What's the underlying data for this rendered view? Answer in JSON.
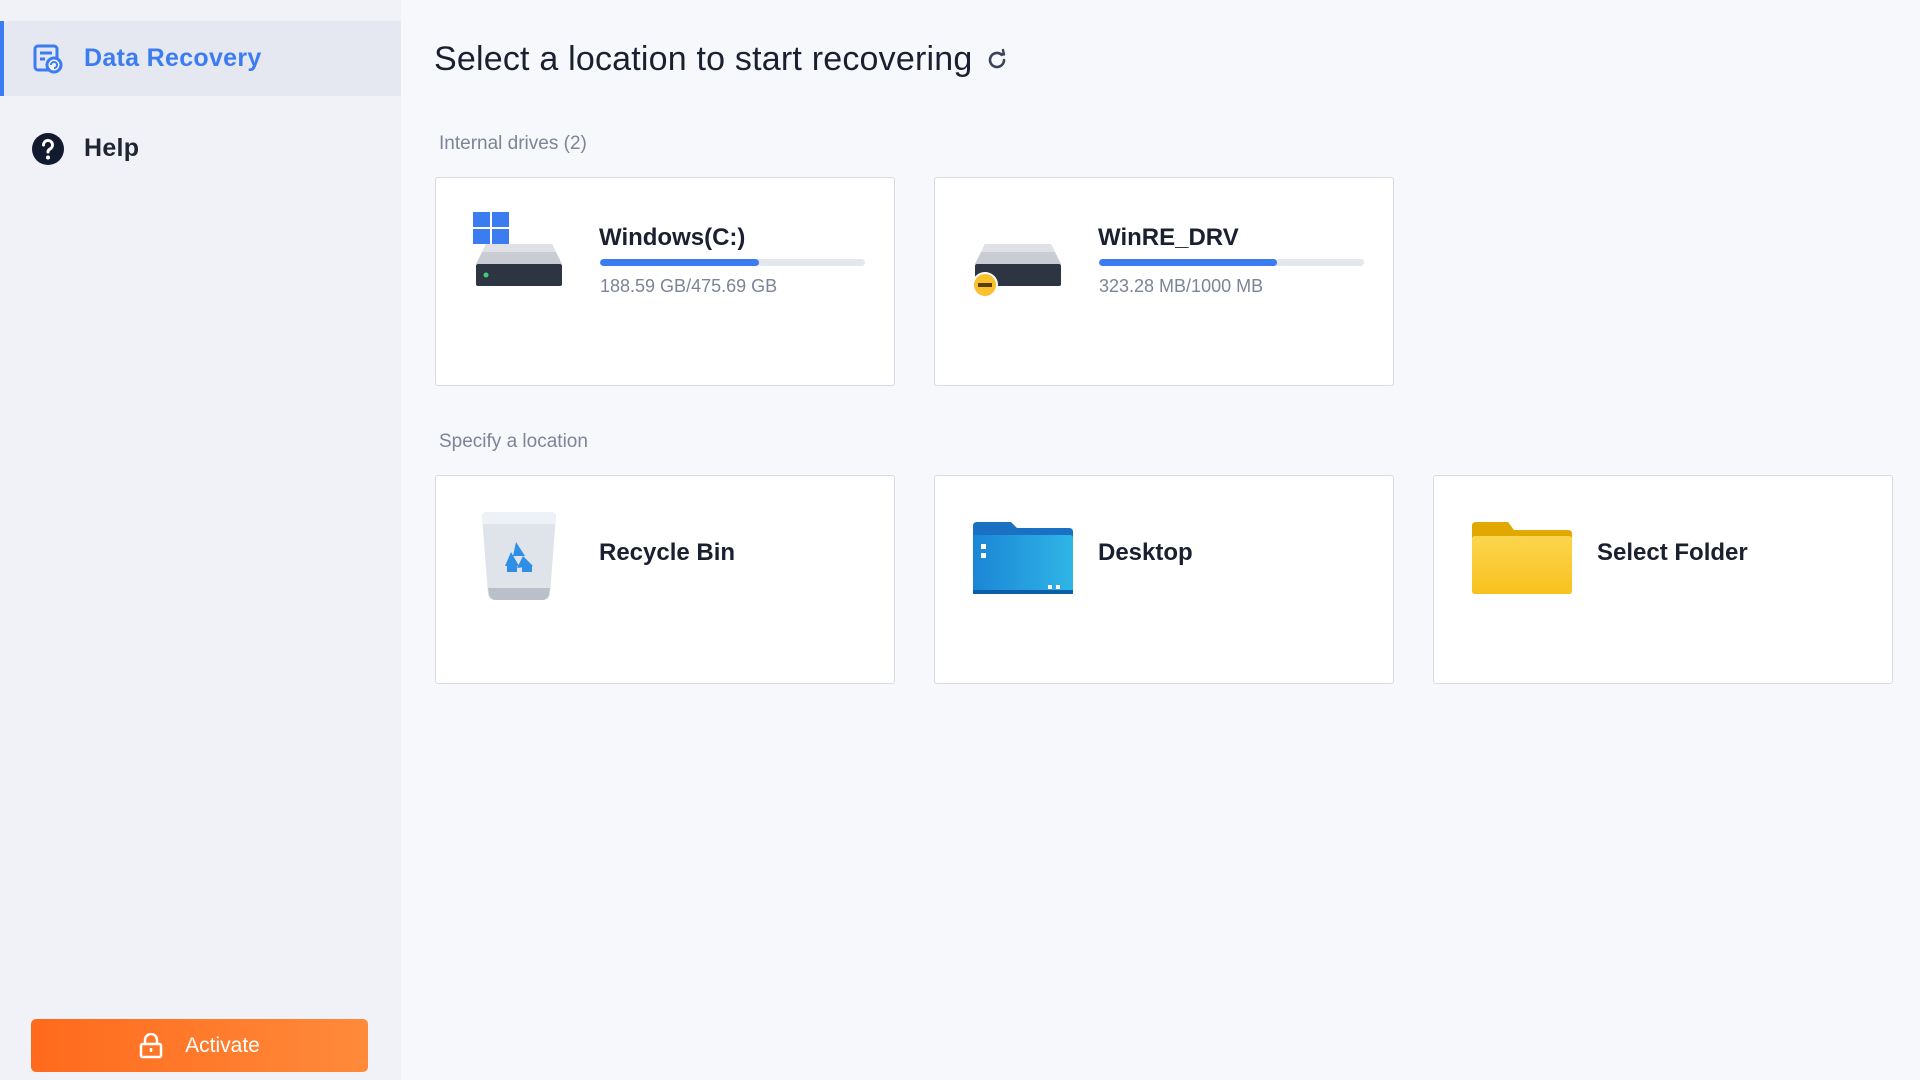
{
  "sidebar": {
    "items": [
      {
        "label": "Data Recovery",
        "icon": "data-recovery-icon",
        "active": true
      },
      {
        "label": "Help",
        "icon": "help-icon",
        "active": false
      }
    ],
    "activate_label": "Activate"
  },
  "main": {
    "title": "Select a location to start recovering",
    "internal_label": "Internal drives (2)",
    "location_label": "Specify a location",
    "drives": [
      {
        "name": "Windows(C:)",
        "usage": "188.59 GB/475.69 GB",
        "used_fraction": 0.6,
        "icon": "windows-drive-icon"
      },
      {
        "name": "WinRE_DRV",
        "usage": "323.28 MB/1000 MB",
        "used_fraction": 0.67,
        "icon": "recovery-drive-icon"
      }
    ],
    "locations": [
      {
        "name": "Recycle Bin",
        "icon": "recycle-bin-icon"
      },
      {
        "name": "Desktop",
        "icon": "desktop-folder-icon"
      },
      {
        "name": "Select Folder",
        "icon": "folder-icon"
      }
    ]
  },
  "colors": {
    "accent": "#3b7cf1",
    "activate": "#ff7424",
    "folder_yellow": "#fbc934",
    "desktop_blue": "#1f8ad4"
  }
}
